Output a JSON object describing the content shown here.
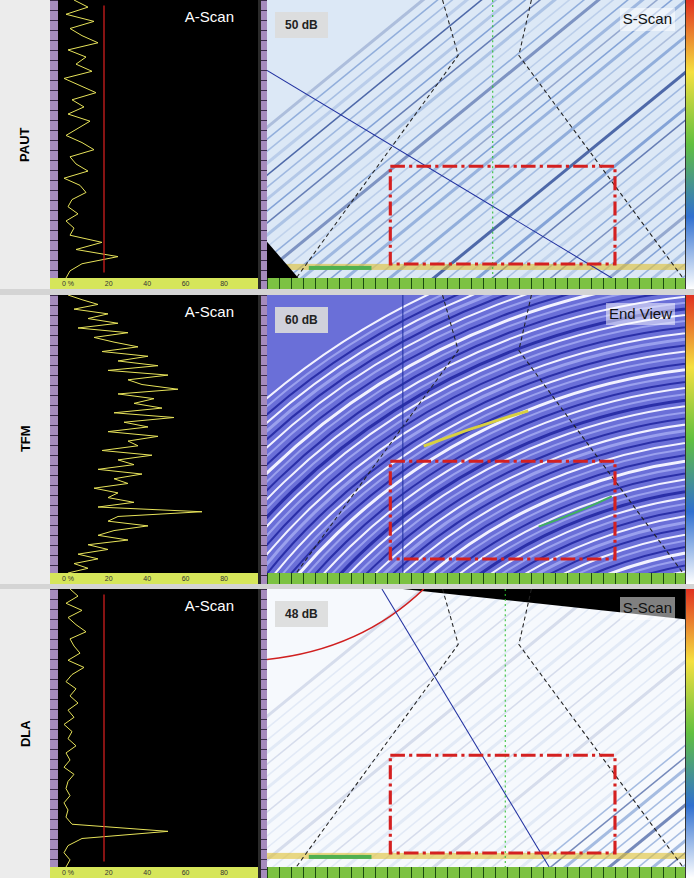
{
  "panels": [
    {
      "method": "PAUT",
      "ascan_title": "A-Scan",
      "gain": "50 dB",
      "view_title": "S-Scan",
      "kind": "s-scan",
      "cursor": true,
      "cursor_level": 0.23,
      "ascan_ticks": [
        "0 %",
        "20",
        "40",
        "60",
        "80"
      ],
      "waveform": [
        8,
        15,
        4,
        18,
        6,
        12,
        20,
        5,
        14,
        9,
        17,
        3,
        11,
        19,
        7,
        13,
        5,
        16,
        10,
        4,
        12,
        18,
        6,
        9,
        15,
        3,
        11,
        14,
        7,
        5,
        10,
        4,
        8,
        6,
        22,
        9,
        30,
        12,
        6,
        4
      ]
    },
    {
      "method": "TFM",
      "ascan_title": "A-Scan",
      "gain": "60 dB",
      "view_title": "End View",
      "kind": "end-view",
      "cursor": false,
      "cursor_level": 0,
      "ascan_ticks": [
        "0 %",
        "20",
        "40",
        "60",
        "80"
      ],
      "waveform": [
        5,
        12,
        20,
        8,
        25,
        15,
        30,
        10,
        35,
        18,
        28,
        40,
        22,
        45,
        30,
        50,
        25,
        55,
        35,
        42,
        60,
        30,
        48,
        38,
        52,
        28,
        58,
        33,
        45,
        25,
        50,
        35,
        40,
        22,
        47,
        30,
        38,
        20,
        42,
        28,
        35,
        18,
        30,
        25,
        38,
        20,
        72,
        30,
        25,
        45,
        28,
        20,
        35,
        15,
        25,
        10,
        20,
        8,
        15,
        5
      ]
    },
    {
      "method": "DLA",
      "ascan_title": "A-Scan",
      "gain": "48 dB",
      "view_title": "S-Scan",
      "kind": "clean",
      "cursor": true,
      "cursor_level": 0.23,
      "ascan_ticks": [
        "0 %",
        "20",
        "40",
        "60",
        "80"
      ],
      "waveform": [
        6,
        10,
        4,
        12,
        5,
        9,
        14,
        6,
        8,
        11,
        5,
        13,
        7,
        4,
        9,
        6,
        10,
        5,
        8,
        3,
        7,
        5,
        9,
        4,
        6,
        3,
        8,
        5,
        4,
        6,
        3,
        5,
        4,
        7,
        55,
        12,
        5,
        3,
        6,
        4
      ]
    }
  ]
}
